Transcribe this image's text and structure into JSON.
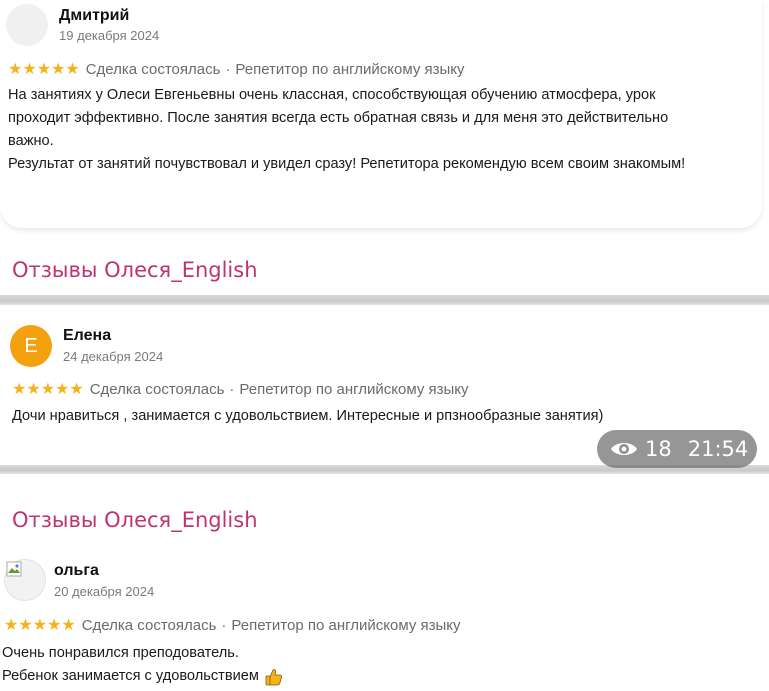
{
  "reviews": [
    {
      "author": "Дмитрий",
      "date": "19 декабря 2024",
      "stars": "★★★★★",
      "deal": "Сделка состоялась",
      "separator": "·",
      "subject": "Репетитор по английскому языку",
      "lines": [
        "На занятиях у Олеси Евгеньевны очень классная, способствующая обучению атмосфера, урок",
        "проходит эффективно. После занятия всегда есть обратная связь и для меня это действительно",
        "важно.",
        "Результат от занятий почувствовал и увидел сразу! Репетитора рекомендую всем своим знакомым!"
      ]
    },
    {
      "author": "Елена",
      "avatar_letter": "Е",
      "date": "24 декабря 2024",
      "stars": "★★★★★",
      "deal": "Сделка состоялась",
      "separator": "·",
      "subject": "Репетитор по английскому языку",
      "lines": [
        "Дочи нравиться , занимается с удовольствием. Интересные и рпзнообразные занятия)"
      ]
    },
    {
      "author": "ольга",
      "date": "20 декабря 2024",
      "stars": "★★★★★",
      "deal": "Сделка состоялась",
      "separator": "·",
      "subject": "Репетитор по английскому языку",
      "lines": [
        "Очень понравился преподователь.",
        "Ребенок занимается с удовольствием"
      ]
    }
  ],
  "section_titles": [
    "Отзывы Олеся_English",
    "Отзывы Олеся_English"
  ],
  "post_info": {
    "views": "18",
    "time": "21:54",
    "icon": "eye-icon"
  },
  "colors": {
    "accent_title": "#c0336f",
    "stars": "#f5b21b",
    "avatar_orange": "#f5a00f"
  }
}
